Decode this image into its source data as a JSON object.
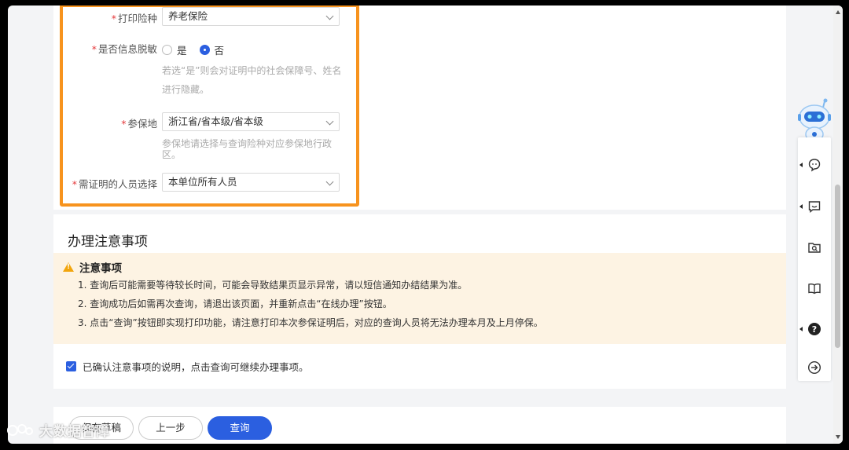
{
  "form": {
    "print_type": {
      "label": "打印险种",
      "value": "养老保险"
    },
    "desensitize": {
      "label": "是否信息脱敏",
      "options": [
        "是",
        "否"
      ],
      "selected": "否",
      "hint_line1": "若选“是”则会对证明中的社会保障号、姓名",
      "hint_line2": "进行隐藏。"
    },
    "insured_place": {
      "label": "参保地",
      "value": "浙江省/省本级/省本级",
      "hint_line1": "参保地请选择与查询险种对应参保地行政",
      "hint_line2": "区。"
    },
    "persons": {
      "label": "需证明的人员选择",
      "value": "本单位所有人员"
    },
    "required_mark": "*"
  },
  "notes": {
    "title": "办理注意事项",
    "notice_title": "注意事项",
    "items": [
      "1. 查询后可能需要等待较长时间，可能会导致结果页显示异常，请以短信通知办结结果为准。",
      "2. 查询成功后如需再次查询，请退出该页面，并重新点击“在线办理”按钮。",
      "3. 点击“查询”按钮即实现打印功能，请注意打印本次参保证明后，对应的查询人员将无法办理本月及上月停保。"
    ],
    "confirm_text": "已确认注意事项的说明，点击查询可继续办理事项。"
  },
  "buttons": {
    "save_draft": "保存草稿",
    "prev": "上一步",
    "query": "查询"
  },
  "watermark": "大数据智障",
  "colors": {
    "primary": "#2b5fe0",
    "highlight": "#f7931e",
    "required": "#e5393b",
    "notice_bg": "#fdf3e3",
    "warning": "#f2a50c"
  },
  "icons": {
    "robot": "robot-assistant-icon",
    "chat": "chat-bubble-icon",
    "message": "message-box-icon",
    "folder_search": "folder-search-icon",
    "book": "book-icon",
    "help": "help-circle-icon",
    "exit": "arrow-right-circle-icon"
  }
}
